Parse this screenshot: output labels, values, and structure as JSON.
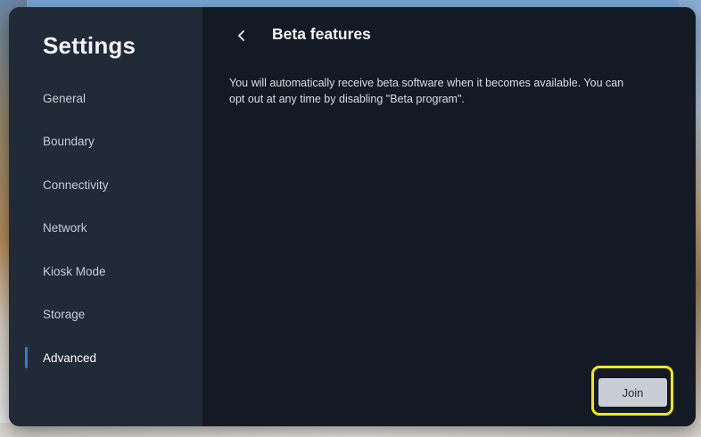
{
  "sidebar": {
    "title": "Settings",
    "items": [
      {
        "label": "General"
      },
      {
        "label": "Boundary"
      },
      {
        "label": "Connectivity"
      },
      {
        "label": "Network"
      },
      {
        "label": "Kiosk Mode"
      },
      {
        "label": "Storage"
      },
      {
        "label": "Advanced",
        "active": true
      }
    ]
  },
  "main": {
    "title": "Beta features",
    "back_icon": "chevron-left-icon",
    "description": "You will automatically receive beta software when it becomes available. You can opt out at any time by disabling \"Beta program\".",
    "join_label": "Join"
  },
  "colors": {
    "sidebar_bg": "#212a37",
    "main_bg": "#131a24",
    "accent": "#2f7bdc",
    "highlight": "#f2ea00",
    "button_bg": "#c8cdd6"
  }
}
